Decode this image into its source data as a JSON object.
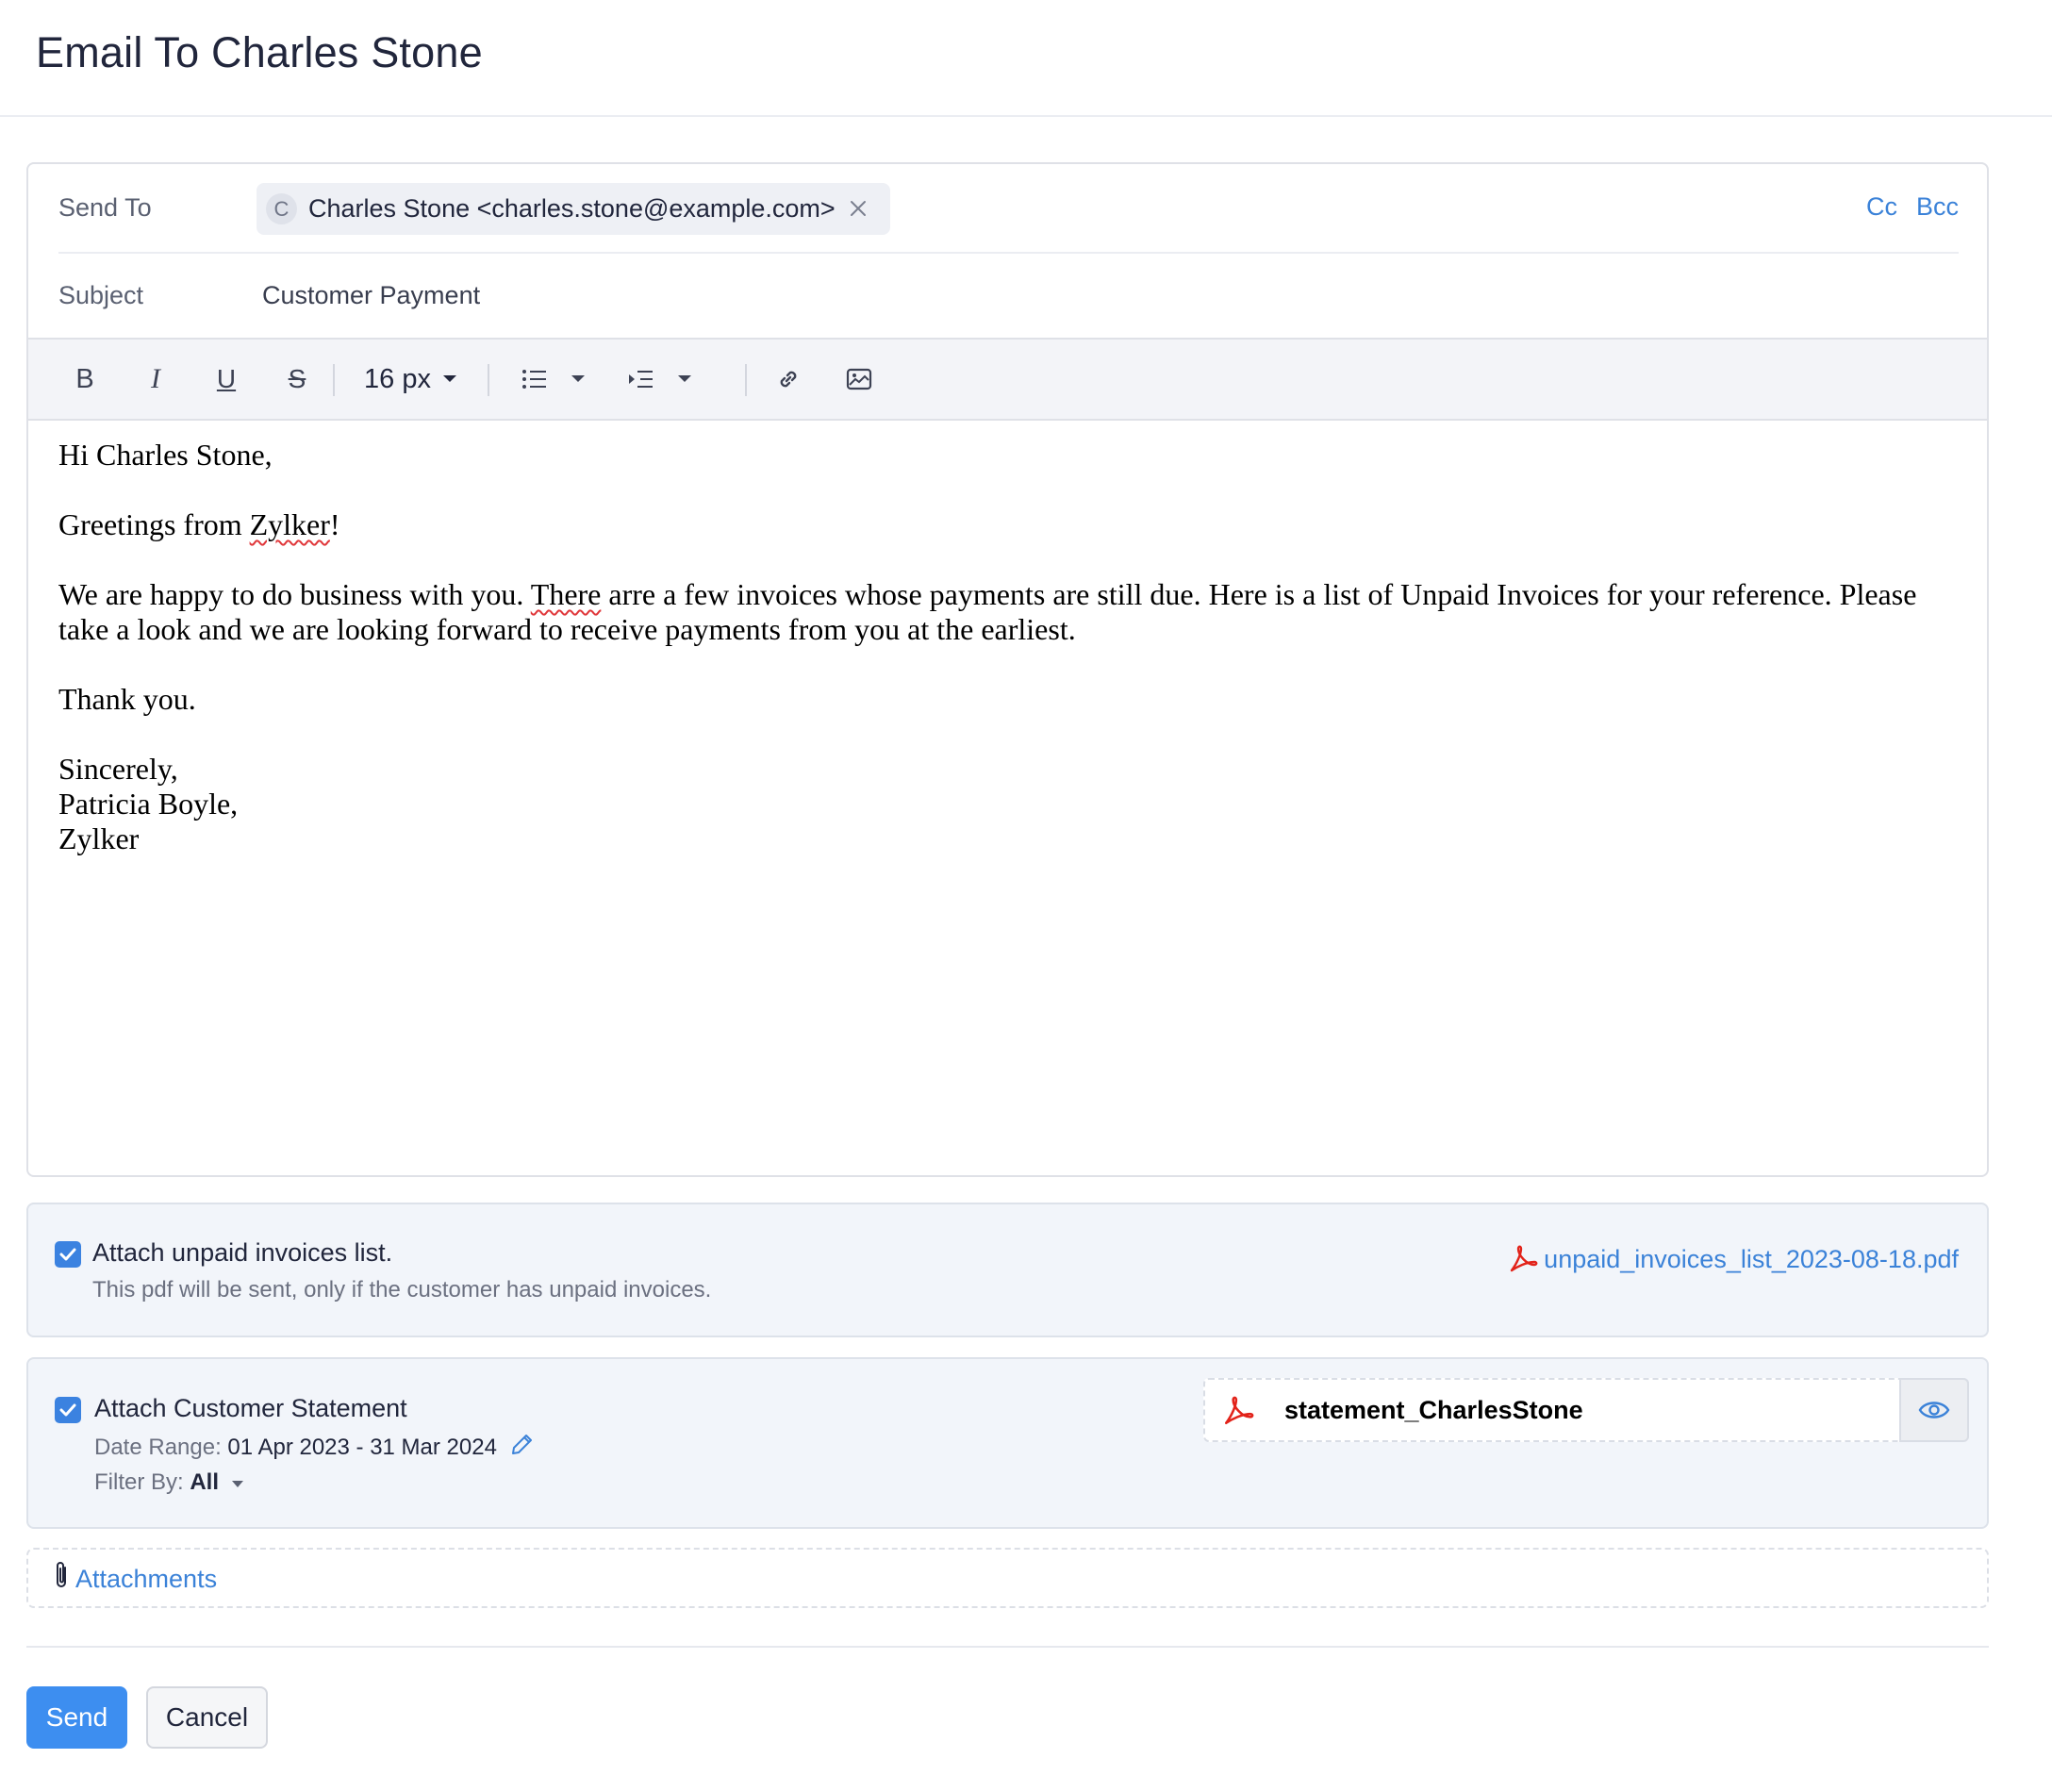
{
  "page": {
    "title": "Email To Charles Stone"
  },
  "compose": {
    "send_to_label": "Send To",
    "recipient": {
      "initial": "C",
      "text": "Charles Stone <charles.stone@example.com>"
    },
    "cc_label": "Cc",
    "bcc_label": "Bcc",
    "subject_label": "Subject",
    "subject_value": "Customer Payment"
  },
  "toolbar": {
    "bold": "B",
    "italic": "I",
    "underline": "U",
    "strike": "S",
    "font_size": "16 px",
    "icons": [
      "bold-icon",
      "italic-icon",
      "underline-icon",
      "strikethrough-icon",
      "bullet-list-icon",
      "indent-icon",
      "link-icon",
      "image-icon"
    ]
  },
  "body": {
    "greeting": "Hi Charles Stone,",
    "greetings_pre": "Greetings from ",
    "greetings_company": "Zylker",
    "greetings_post": "!",
    "para_pre": "We are happy to do business with you. ",
    "para_spell": "There",
    "para_post": " arre a few invoices whose payments are still due. Here is a list of Unpaid Invoices for your reference. Please take a look and we are looking forward to receive payments from you at the earliest.",
    "thanks": "Thank you.",
    "sign_1": "Sincerely,",
    "sign_2": "Patricia Boyle,",
    "sign_3": "Zylker"
  },
  "unpaid_panel": {
    "title": "Attach unpaid invoices list.",
    "subtitle": "This pdf will be sent, only if the customer has unpaid invoices.",
    "file": "unpaid_invoices_list_2023-08-18.pdf",
    "checked": true
  },
  "statement_panel": {
    "title": "Attach Customer Statement",
    "date_range_label": "Date Range: ",
    "date_range_value": "01 Apr 2023 - 31 Mar 2024",
    "filter_label": "Filter By: ",
    "filter_value": "All",
    "file": "statement_CharlesStone",
    "checked": true
  },
  "attachments": {
    "label": "Attachments"
  },
  "actions": {
    "send": "Send",
    "cancel": "Cancel"
  },
  "colors": {
    "accent": "#3d8ef0",
    "link": "#3b82d8",
    "pdf_red": "#e2231a",
    "panel_bg": "#f2f5fa"
  }
}
